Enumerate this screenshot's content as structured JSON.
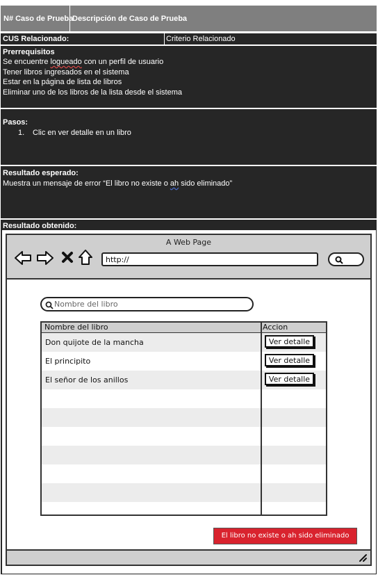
{
  "header": {
    "col1": "N# Caso de Prueba",
    "col2": "Descripción de Caso de Prueba"
  },
  "cus": {
    "label": "CUS Relacionado:",
    "criterio": "Criterio Relacionado"
  },
  "prereq": {
    "title": "Prerrequisitos",
    "line1_pre": "Se encuentre ",
    "line1_word": "logueado",
    "line1_post": " con un perfil de usuario",
    "line2": "Tener libros ingresados en el sistema",
    "line3": "Estar en la página de lista de libros",
    "line4": "Eliminar uno de los libros de la lista desde el sistema"
  },
  "pasos": {
    "title": "Pasos:",
    "num": "1.",
    "step1": "Clic en ver detalle en un libro"
  },
  "esperado": {
    "title": "Resultado esperado:",
    "pre": "Muestra un mensaje de error “El libro no existe o ",
    "word": "ah",
    "post": " sido eliminado”"
  },
  "obtenido": {
    "title": "Resultado obtenido:"
  },
  "mockup": {
    "window_title": "A Web Page",
    "url": "http://",
    "search_placeholder": "Nombre del libro",
    "columns": [
      "Nombre del libro",
      "Accion"
    ],
    "rows": [
      {
        "name": "Don quijote de la mancha",
        "action": "Ver detalle"
      },
      {
        "name": "El principito",
        "action": "Ver detalle"
      },
      {
        "name": "El señor de los anillos",
        "action": "Ver detalle"
      }
    ],
    "error_message": "El libro no existe o ah sido eliminado",
    "icons": [
      "back-arrow-icon",
      "forward-arrow-icon",
      "close-icon",
      "home-icon",
      "search-icon",
      "resize-grip-icon"
    ],
    "colors": {
      "error": "#d9232e",
      "chrome": "#cfcfcf",
      "doc_dark": "#262626",
      "doc_gray": "#7f7f7f"
    }
  }
}
